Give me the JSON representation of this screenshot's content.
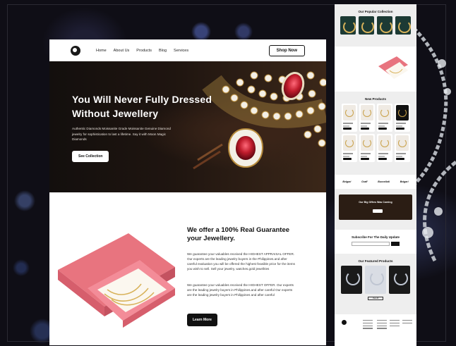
{
  "nav": {
    "links": [
      "Home",
      "About Us",
      "Products",
      "Blog",
      "Services"
    ],
    "cta": "Shop Now"
  },
  "hero": {
    "title": "You Will Never Fully Dressed Without Jewellery",
    "subtitle": "Authentic Diamonds Moissanite Grade Moissanite Genuine Diamond jewelry for sophistication to last a lifetime. Say it with Moon Magic Diamonds",
    "button": "See Collection"
  },
  "offer": {
    "title": "We offer a 100% Real Guarantee your Jewellery.",
    "para1": "We guarantee your valuables received the HIGHEST APPRAISAL OFFER. Our experts are the leading jewelry buyers in the Philippines.and after careful evaluation you will be offered the highest feasible price for the items you wish to sell. Sell your jewelry, watches.gold jewellries",
    "para2": "We guarantee your valuables received the HIGHEST OFFER. Our experts are the leading jewelry buyers in Philippines.and after careful Our experts are the leading jewelry buyers in Philippines and after careful",
    "button": "Learn More"
  },
  "long_page": {
    "popular_title": "Our Popular Collection",
    "new_products_title": "New Products",
    "brands": [
      "Bvlgari",
      "Graff",
      "Buccellati",
      "Bvlgari"
    ],
    "big_offer": "Our Big Offers Was Coming",
    "subscribe": "Subscribe For The Daily Update",
    "featured_title": "Our Featured Products",
    "view_all": "View All"
  },
  "colors": {
    "hero_bg": "#1f1510",
    "ruby": "#c01c2c",
    "gold": "#c9a14a",
    "box_pink": "#f08a98"
  }
}
